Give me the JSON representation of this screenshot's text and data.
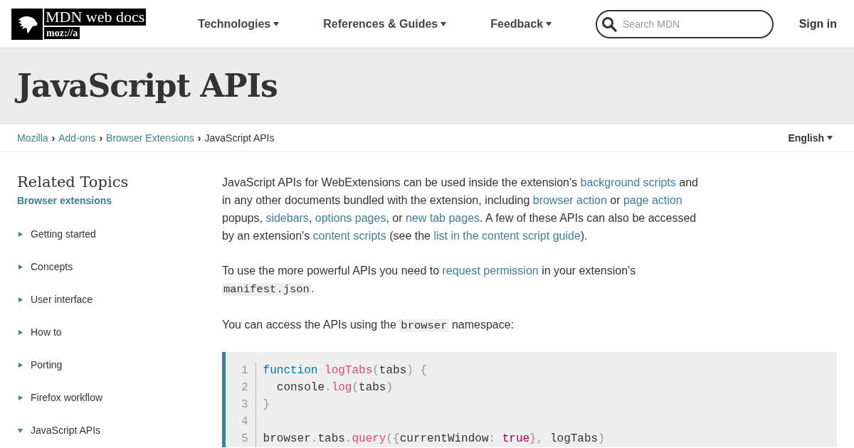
{
  "header": {
    "logo": {
      "title": "MDN web docs",
      "subtitle": "moz://a"
    },
    "nav": [
      {
        "label": "Technologies"
      },
      {
        "label": "References & Guides"
      },
      {
        "label": "Feedback"
      }
    ],
    "search": {
      "placeholder": "Search MDN"
    },
    "sign_in": "Sign in"
  },
  "page_title": "JavaScript APIs",
  "breadcrumbs": [
    {
      "label": "Mozilla",
      "link": true
    },
    {
      "separator": "›",
      "label": "Add-ons",
      "link": true
    },
    {
      "separator": "›",
      "label": "Browser Extensions",
      "link": true
    },
    {
      "separator": "›",
      "label": "JavaScript APIs",
      "link": false
    }
  ],
  "language": "English",
  "sidebar": {
    "heading": "Related Topics",
    "section": "Browser extensions",
    "items": [
      {
        "label": "Getting started",
        "expanded": false
      },
      {
        "label": "Concepts",
        "expanded": false
      },
      {
        "label": "User interface",
        "expanded": false
      },
      {
        "label": "How to",
        "expanded": false
      },
      {
        "label": "Porting",
        "expanded": false
      },
      {
        "label": "Firefox workflow",
        "expanded": false
      },
      {
        "label": "JavaScript APIs",
        "expanded": true
      }
    ]
  },
  "paragraphs": [
    [
      {
        "kind": "text",
        "text": "JavaScript APIs for WebExtensions can be used inside the extension's "
      },
      {
        "kind": "link",
        "text": "background scripts"
      },
      {
        "kind": "text",
        "text": " and in any other documents bundled with the extension, including "
      },
      {
        "kind": "link",
        "text": "browser action"
      },
      {
        "kind": "text",
        "text": " or "
      },
      {
        "kind": "link",
        "text": "page action"
      },
      {
        "kind": "text",
        "text": " popups, "
      },
      {
        "kind": "link",
        "text": "sidebars"
      },
      {
        "kind": "text",
        "text": ", "
      },
      {
        "kind": "link",
        "text": "options pages"
      },
      {
        "kind": "text",
        "text": ", or "
      },
      {
        "kind": "link",
        "text": "new tab pages"
      },
      {
        "kind": "text",
        "text": ". A few of these APIs can also be accessed by an extension's "
      },
      {
        "kind": "link",
        "text": "content scripts"
      },
      {
        "kind": "text",
        "text": " (see the "
      },
      {
        "kind": "link",
        "text": "list in the content script guide"
      },
      {
        "kind": "text",
        "text": ")."
      }
    ],
    [
      {
        "kind": "text",
        "text": "To use the more powerful APIs you need to "
      },
      {
        "kind": "link",
        "text": "request permission"
      },
      {
        "kind": "text",
        "text": " in your extension's "
      },
      {
        "kind": "code",
        "text": "manifest.json"
      },
      {
        "kind": "text",
        "text": "."
      }
    ],
    [
      {
        "kind": "text",
        "text": "You can access the APIs using the "
      },
      {
        "kind": "code",
        "text": "browser"
      },
      {
        "kind": "text",
        "text": " namespace:"
      }
    ]
  ],
  "code": [
    {
      "number": "1",
      "tokens": [
        {
          "kind": "keyword",
          "text": "function"
        },
        {
          "kind": "function",
          "text": " logTabs"
        },
        {
          "kind": "punct",
          "text": "("
        },
        {
          "kind": "plain",
          "text": "tabs"
        },
        {
          "kind": "punct",
          "text": ") {"
        }
      ]
    },
    {
      "number": "2",
      "tokens": [
        {
          "kind": "plain",
          "text": "  console"
        },
        {
          "kind": "punct",
          "text": "."
        },
        {
          "kind": "function",
          "text": "log"
        },
        {
          "kind": "punct",
          "text": "("
        },
        {
          "kind": "plain",
          "text": "tabs"
        },
        {
          "kind": "punct",
          "text": ")"
        }
      ]
    },
    {
      "number": "3",
      "tokens": [
        {
          "kind": "punct",
          "text": "}"
        }
      ]
    },
    {
      "number": "4"
    },
    {
      "number": "5",
      "tokens": [
        {
          "kind": "plain",
          "text": "browser"
        },
        {
          "kind": "punct",
          "text": "."
        },
        {
          "kind": "plain",
          "text": "tabs"
        },
        {
          "kind": "punct",
          "text": "."
        },
        {
          "kind": "function",
          "text": "query"
        },
        {
          "kind": "punct",
          "text": "({"
        },
        {
          "kind": "plain",
          "text": "currentWindow"
        },
        {
          "kind": "punct",
          "text": ": "
        },
        {
          "kind": "boolean",
          "text": "true"
        },
        {
          "kind": "punct",
          "text": "}, "
        },
        {
          "kind": "plain",
          "text": "logTabs"
        },
        {
          "kind": "punct",
          "text": ")"
        }
      ]
    }
  ]
}
